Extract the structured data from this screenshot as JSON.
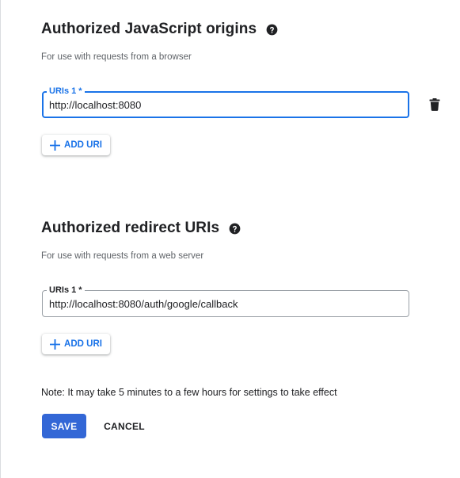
{
  "origins": {
    "title": "Authorized JavaScript origins",
    "help_icon": "help-circle-icon",
    "subtext": "For use with requests from a browser",
    "field_label": "URIs 1 *",
    "field_value": "http://localhost:8080",
    "delete_icon": "trash-icon",
    "add_label": "ADD URI"
  },
  "redirects": {
    "title": "Authorized redirect URIs",
    "help_icon": "help-circle-icon",
    "subtext": "For use with requests from a web server",
    "field_label": "URIs 1 *",
    "field_value": "http://localhost:8080/auth/google/callback",
    "add_label": "ADD URI"
  },
  "note": "Note: It may take 5 minutes to a few hours for settings to take effect",
  "actions": {
    "save_label": "SAVE",
    "cancel_label": "CANCEL"
  },
  "colors": {
    "accent": "#1a73e8",
    "save_bg": "#3367d6"
  }
}
